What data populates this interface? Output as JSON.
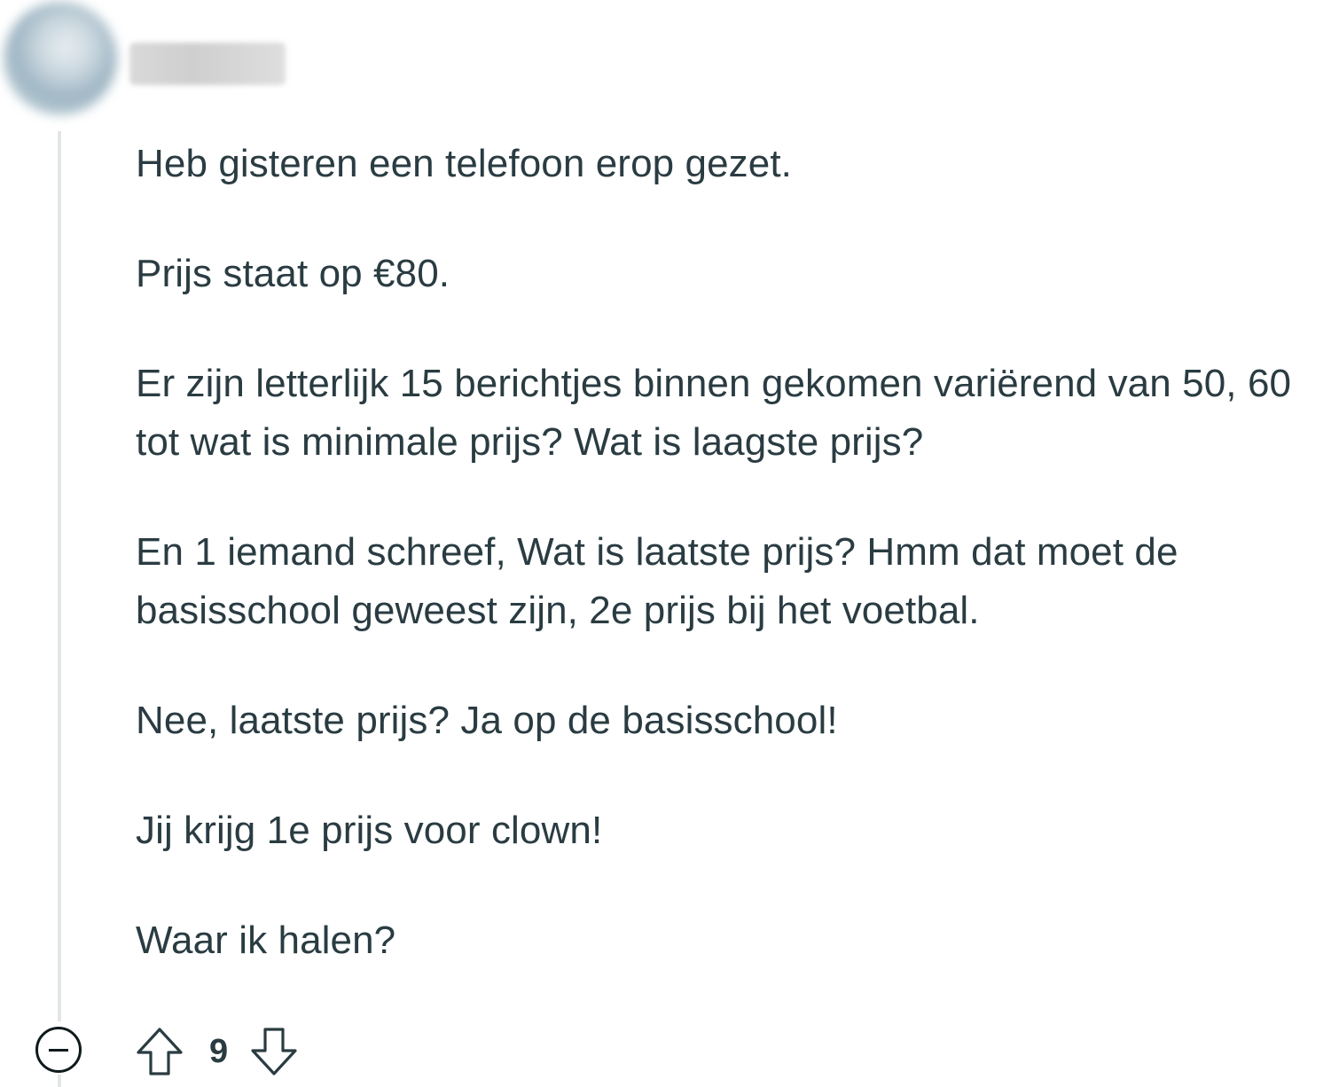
{
  "comment": {
    "author_redacted": true,
    "paragraphs": [
      "Heb gisteren een telefoon erop gezet.",
      "Prijs staat op €80.",
      "Er zijn letterlijk 15 berichtjes binnen gekomen variërend van 50, 60 tot wat is minimale prijs? Wat is laagste prijs?",
      "En 1 iemand schreef, Wat is laatste prijs? Hmm dat moet de basisschool geweest zijn, 2e prijs bij het voetbal.",
      "Nee, laatste prijs? Ja op de basisschool!",
      "Jij krijg 1e prijs voor clown!",
      "Waar ik halen?"
    ],
    "score": "9"
  },
  "icons": {
    "collapse": "minus-circle-icon",
    "upvote": "arrow-up-icon",
    "downvote": "arrow-down-icon"
  },
  "colors": {
    "text": "#2a3c42",
    "thread_line": "#e3e6e8",
    "icon": "#0f1a1c"
  }
}
